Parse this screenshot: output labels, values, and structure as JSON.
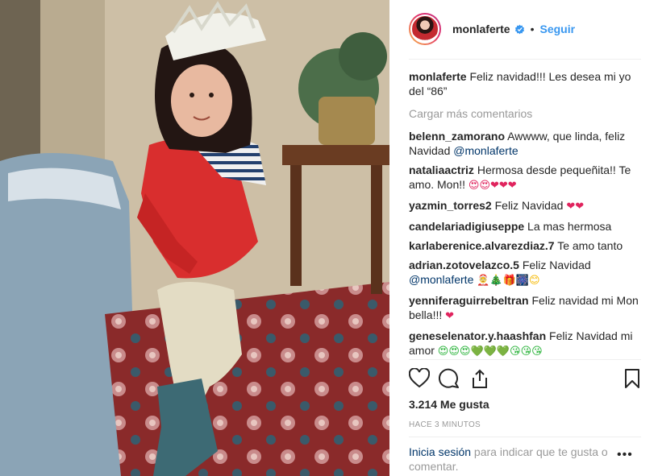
{
  "post": {
    "owner": "monlaferte",
    "follow_label": "Seguir",
    "dot": "•",
    "photo_alt": "Foto de una niña con vestido rojo y corona de papel"
  },
  "caption": {
    "user": "monlaferte",
    "text": " Feliz navidad!!! Les desea mi yo del “86”"
  },
  "load_more": "Cargar más comentarios",
  "comments": [
    {
      "user": "belenn_zamorano",
      "text": " Awwww, que linda, feliz Navidad ",
      "mention": "@monlaferte",
      "emoji": ""
    },
    {
      "user": "nataliaactriz",
      "text": " Hermosa desde pequeñita!! Te amo. Mon!! ",
      "mention": "",
      "emoji": "😍😍❤❤❤"
    },
    {
      "user": "yazmin_torres2",
      "text": " Feliz Navidad ",
      "mention": "",
      "emoji": "❤❤"
    },
    {
      "user": "candelariadigiuseppe",
      "text": " La mas hermosa",
      "mention": "",
      "emoji": ""
    },
    {
      "user": "karlaberenice.alvarezdiaz.7",
      "text": " Te amo tanto",
      "mention": "",
      "emoji": ""
    },
    {
      "user": "adrian.zotovelazco.5",
      "text": " Feliz Navidad ",
      "mention": "@monlaferte",
      "emoji": "🤶🎄🎁🎆😊"
    },
    {
      "user": "yenniferaguirrebeltran",
      "text": " Feliz navidad mi Mon bella!!! ",
      "mention": "",
      "emoji": "❤"
    },
    {
      "user": "geneselenator.y.haashfan",
      "text": " Feliz Navidad mi amor ",
      "mention": "",
      "emoji": "😍😍😍💚💚💚😘😘😘"
    }
  ],
  "likes": "3.214 Me gusta",
  "time": "HACE 3 MINUTOS",
  "footer": {
    "login": "Inicia sesión",
    "rest": " para indicar que te gusta o comentar."
  },
  "more_label": "•••",
  "colors": {
    "link": "#3897f0",
    "mention": "#003569",
    "muted": "#999999",
    "heart": "#e0245e"
  },
  "icons": [
    "verified-badge-icon",
    "heart-icon",
    "comment-icon",
    "share-icon",
    "bookmark-icon",
    "more-options-icon"
  ]
}
